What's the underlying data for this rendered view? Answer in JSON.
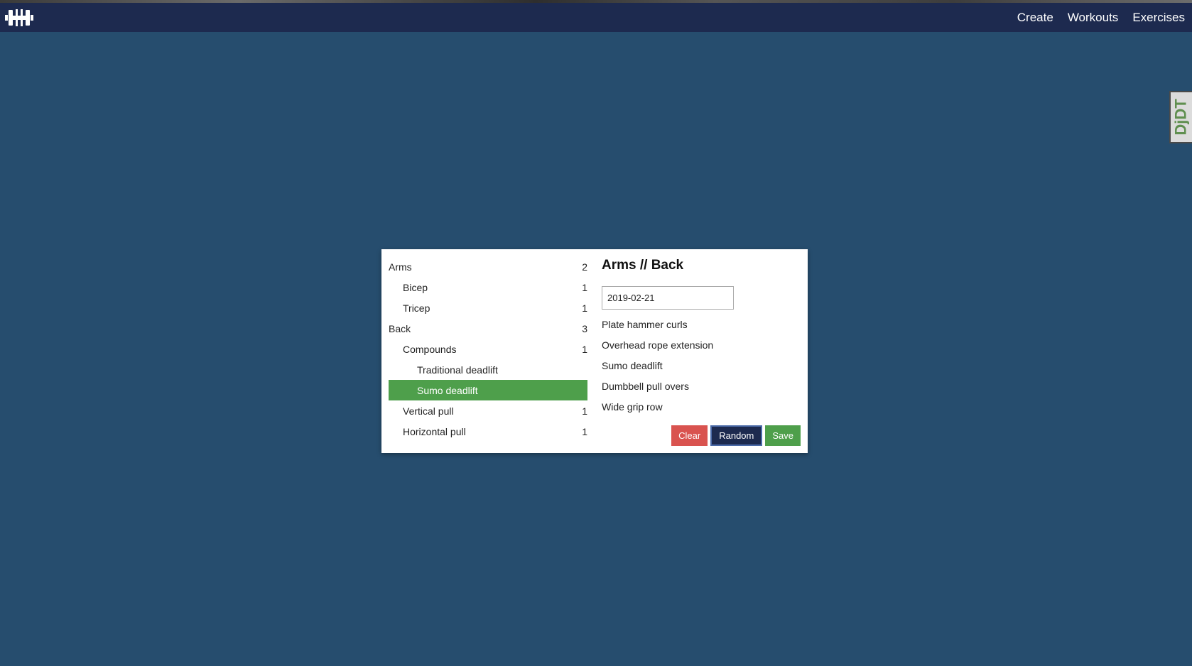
{
  "nav": {
    "links": [
      "Create",
      "Workouts",
      "Exercises"
    ]
  },
  "debug_toolbar": {
    "label": "DjDT"
  },
  "categories": [
    {
      "label": "Arms",
      "count": "2",
      "level": 0
    },
    {
      "label": "Bicep",
      "count": "1",
      "level": 1
    },
    {
      "label": "Tricep",
      "count": "1",
      "level": 1
    },
    {
      "label": "Back",
      "count": "3",
      "level": 0
    },
    {
      "label": "Compounds",
      "count": "1",
      "level": 1
    },
    {
      "label": "Traditional deadlift",
      "count": "",
      "level": 2
    },
    {
      "label": "Sumo deadlift",
      "count": "",
      "level": 2,
      "selected": true
    },
    {
      "label": "Vertical pull",
      "count": "1",
      "level": 1
    },
    {
      "label": "Horizontal pull",
      "count": "1",
      "level": 1
    }
  ],
  "detail": {
    "title": "Arms // Back",
    "date": "2019-02-21",
    "exercises": [
      "Plate hammer curls",
      "Overhead rope extension",
      "Sumo deadlift",
      "Dumbbell pull overs",
      "Wide grip row"
    ]
  },
  "buttons": {
    "clear": "Clear",
    "random": "Random",
    "save": "Save"
  },
  "colors": {
    "page_bg": "#264d6e",
    "navbar_bg": "#1d2a4f",
    "selected_bg": "#4e9f4b",
    "clear_bg": "#d9534f",
    "random_bg": "#1d2a4f",
    "save_bg": "#4e9f4b"
  },
  "icons": {
    "logo": "dumbbell-icon"
  }
}
